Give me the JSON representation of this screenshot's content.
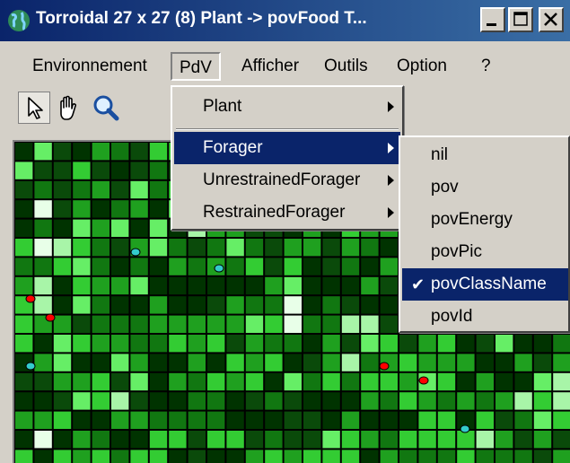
{
  "window": {
    "title": "Torroidal 27 x 27 (8)  Plant -> povFood  T..."
  },
  "menubar": {
    "items": [
      "Environnement",
      "PdV",
      "Afficher",
      "Outils",
      "Option",
      "?"
    ]
  },
  "toolbar": {
    "tools": [
      "arrow-icon",
      "hand-icon",
      "magnifier-icon"
    ]
  },
  "pdv_menu": {
    "items": [
      {
        "label": "Plant",
        "submenu": true
      },
      {
        "label": "Forager",
        "submenu": true,
        "selected": true
      },
      {
        "label": "UnrestrainedForager",
        "submenu": true
      },
      {
        "label": "RestrainedForager",
        "submenu": true
      }
    ]
  },
  "forager_submenu": {
    "items": [
      {
        "label": "nil"
      },
      {
        "label": "pov"
      },
      {
        "label": "povEnergy"
      },
      {
        "label": "povPic"
      },
      {
        "label": "povClassName",
        "checked": true,
        "selected": true
      },
      {
        "label": "povId"
      }
    ],
    "check_glyph": "✔"
  },
  "colors": {
    "title_start": "#0a246a",
    "title_end": "#3a6ea5",
    "selection": "#0a246a",
    "face": "#d4d0c8",
    "cell_palette": [
      "#003300",
      "#0a4a0a",
      "#117711",
      "#1fa01f",
      "#33cc33",
      "#66ee66",
      "#a8f5a8",
      "#e8ffe8"
    ],
    "agent_red": "#ff0000",
    "agent_cyan": "#33cccc"
  }
}
